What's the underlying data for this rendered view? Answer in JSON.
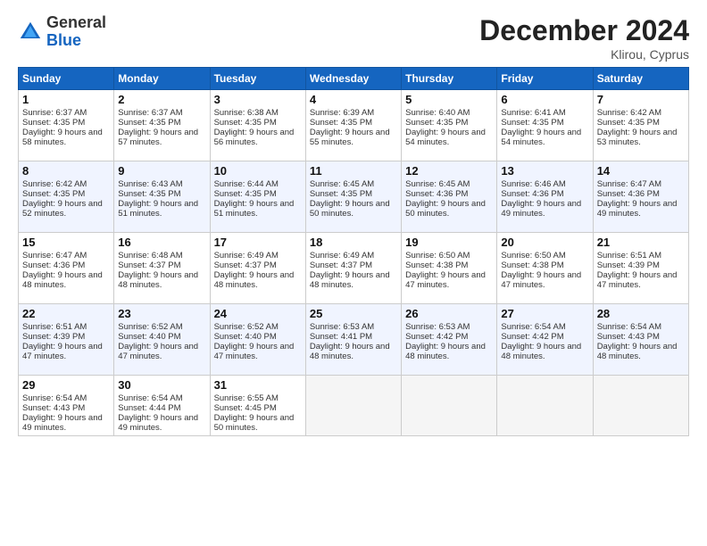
{
  "header": {
    "logo_general": "General",
    "logo_blue": "Blue",
    "month_title": "December 2024",
    "location": "Klirou, Cyprus"
  },
  "days_of_week": [
    "Sunday",
    "Monday",
    "Tuesday",
    "Wednesday",
    "Thursday",
    "Friday",
    "Saturday"
  ],
  "weeks": [
    [
      {
        "day": "1",
        "sunrise": "6:37 AM",
        "sunset": "4:35 PM",
        "daylight": "9 hours and 58 minutes."
      },
      {
        "day": "2",
        "sunrise": "6:37 AM",
        "sunset": "4:35 PM",
        "daylight": "9 hours and 57 minutes."
      },
      {
        "day": "3",
        "sunrise": "6:38 AM",
        "sunset": "4:35 PM",
        "daylight": "9 hours and 56 minutes."
      },
      {
        "day": "4",
        "sunrise": "6:39 AM",
        "sunset": "4:35 PM",
        "daylight": "9 hours and 55 minutes."
      },
      {
        "day": "5",
        "sunrise": "6:40 AM",
        "sunset": "4:35 PM",
        "daylight": "9 hours and 54 minutes."
      },
      {
        "day": "6",
        "sunrise": "6:41 AM",
        "sunset": "4:35 PM",
        "daylight": "9 hours and 54 minutes."
      },
      {
        "day": "7",
        "sunrise": "6:42 AM",
        "sunset": "4:35 PM",
        "daylight": "9 hours and 53 minutes."
      }
    ],
    [
      {
        "day": "8",
        "sunrise": "6:42 AM",
        "sunset": "4:35 PM",
        "daylight": "9 hours and 52 minutes."
      },
      {
        "day": "9",
        "sunrise": "6:43 AM",
        "sunset": "4:35 PM",
        "daylight": "9 hours and 51 minutes."
      },
      {
        "day": "10",
        "sunrise": "6:44 AM",
        "sunset": "4:35 PM",
        "daylight": "9 hours and 51 minutes."
      },
      {
        "day": "11",
        "sunrise": "6:45 AM",
        "sunset": "4:35 PM",
        "daylight": "9 hours and 50 minutes."
      },
      {
        "day": "12",
        "sunrise": "6:45 AM",
        "sunset": "4:36 PM",
        "daylight": "9 hours and 50 minutes."
      },
      {
        "day": "13",
        "sunrise": "6:46 AM",
        "sunset": "4:36 PM",
        "daylight": "9 hours and 49 minutes."
      },
      {
        "day": "14",
        "sunrise": "6:47 AM",
        "sunset": "4:36 PM",
        "daylight": "9 hours and 49 minutes."
      }
    ],
    [
      {
        "day": "15",
        "sunrise": "6:47 AM",
        "sunset": "4:36 PM",
        "daylight": "9 hours and 48 minutes."
      },
      {
        "day": "16",
        "sunrise": "6:48 AM",
        "sunset": "4:37 PM",
        "daylight": "9 hours and 48 minutes."
      },
      {
        "day": "17",
        "sunrise": "6:49 AM",
        "sunset": "4:37 PM",
        "daylight": "9 hours and 48 minutes."
      },
      {
        "day": "18",
        "sunrise": "6:49 AM",
        "sunset": "4:37 PM",
        "daylight": "9 hours and 48 minutes."
      },
      {
        "day": "19",
        "sunrise": "6:50 AM",
        "sunset": "4:38 PM",
        "daylight": "9 hours and 47 minutes."
      },
      {
        "day": "20",
        "sunrise": "6:50 AM",
        "sunset": "4:38 PM",
        "daylight": "9 hours and 47 minutes."
      },
      {
        "day": "21",
        "sunrise": "6:51 AM",
        "sunset": "4:39 PM",
        "daylight": "9 hours and 47 minutes."
      }
    ],
    [
      {
        "day": "22",
        "sunrise": "6:51 AM",
        "sunset": "4:39 PM",
        "daylight": "9 hours and 47 minutes."
      },
      {
        "day": "23",
        "sunrise": "6:52 AM",
        "sunset": "4:40 PM",
        "daylight": "9 hours and 47 minutes."
      },
      {
        "day": "24",
        "sunrise": "6:52 AM",
        "sunset": "4:40 PM",
        "daylight": "9 hours and 47 minutes."
      },
      {
        "day": "25",
        "sunrise": "6:53 AM",
        "sunset": "4:41 PM",
        "daylight": "9 hours and 48 minutes."
      },
      {
        "day": "26",
        "sunrise": "6:53 AM",
        "sunset": "4:42 PM",
        "daylight": "9 hours and 48 minutes."
      },
      {
        "day": "27",
        "sunrise": "6:54 AM",
        "sunset": "4:42 PM",
        "daylight": "9 hours and 48 minutes."
      },
      {
        "day": "28",
        "sunrise": "6:54 AM",
        "sunset": "4:43 PM",
        "daylight": "9 hours and 48 minutes."
      }
    ],
    [
      {
        "day": "29",
        "sunrise": "6:54 AM",
        "sunset": "4:43 PM",
        "daylight": "9 hours and 49 minutes."
      },
      {
        "day": "30",
        "sunrise": "6:54 AM",
        "sunset": "4:44 PM",
        "daylight": "9 hours and 49 minutes."
      },
      {
        "day": "31",
        "sunrise": "6:55 AM",
        "sunset": "4:45 PM",
        "daylight": "9 hours and 50 minutes."
      },
      null,
      null,
      null,
      null
    ]
  ]
}
